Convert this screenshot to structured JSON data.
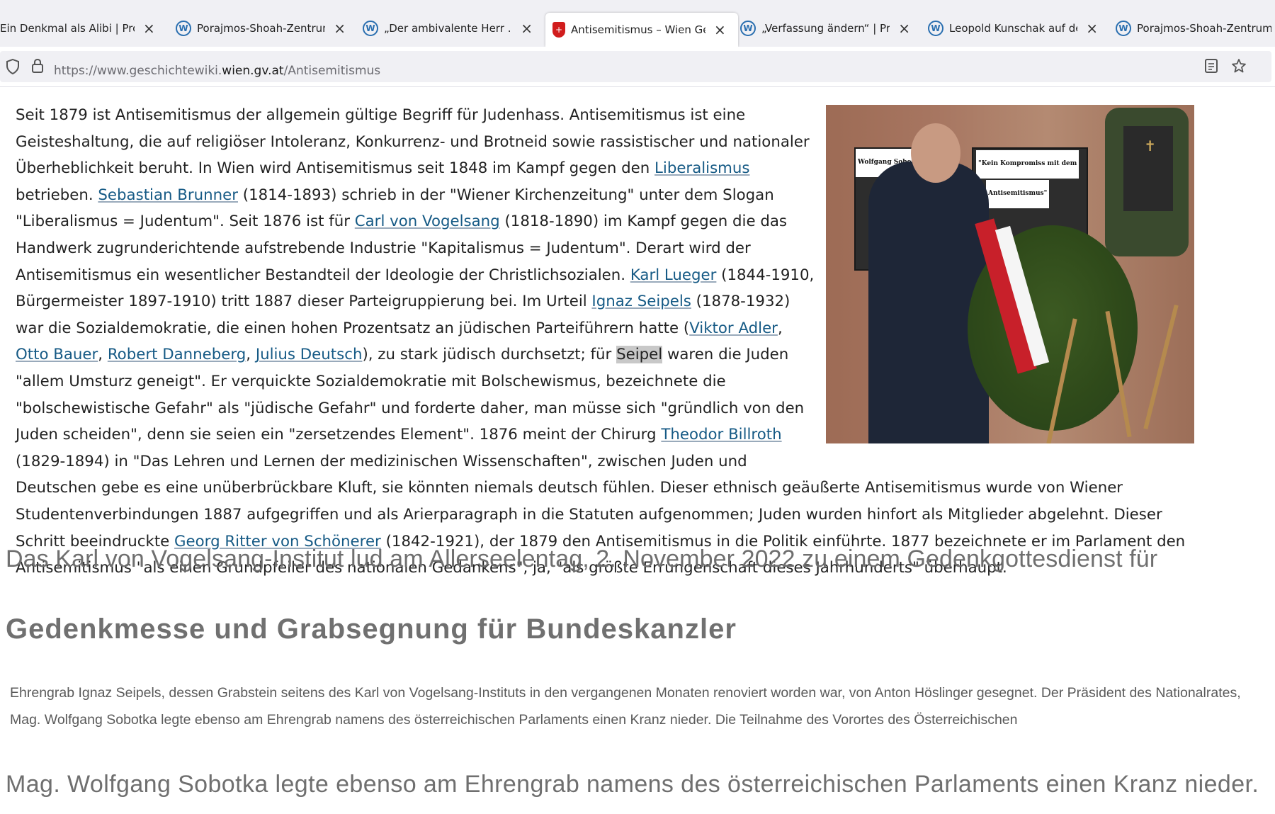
{
  "tabs": [
    {
      "title": "Ein Denkmal als Alibi | Pron",
      "icon": "wordpress-icon",
      "active": false
    },
    {
      "title": "Porajmos-Shoah-Zentrum",
      "icon": "wordpress-icon",
      "active": false
    },
    {
      "title": "„Der ambivalente Herr …“ |",
      "icon": "wordpress-icon",
      "active": false
    },
    {
      "title": "Antisemitismus – Wien Ges",
      "icon": "vienna-shield-icon",
      "active": true
    },
    {
      "title": "„Verfassung ändern“ | Pron",
      "icon": "wordpress-icon",
      "active": false
    },
    {
      "title": "Leopold Kunschak auf dem",
      "icon": "wordpress-icon",
      "active": false
    },
    {
      "title": "Porajmos-Shoah-Zentrum",
      "icon": "wordpress-icon",
      "active": false
    }
  ],
  "url": {
    "prefix": "https://www.geschichtewiki.",
    "domain": "wien.gv.at",
    "path": "/Antisemitismus"
  },
  "photo": {
    "sign_left": "Wolfgang Sobotka:",
    "sign_right_1": "\"Kein Kompromiss mit dem",
    "sign_right_2": "Antisemitismus\""
  },
  "article": {
    "s1": "Seit 1879 ist Antisemitismus der allgemein gültige Begriff für Judenhass. Antisemitismus ist eine Geisteshaltung, die auf religiöser Intoleranz, Konkurrenz- und Brotneid sowie rassistischer und nationaler Überheblichkeit beruht. In Wien wird Antisemitismus seit 1848 im Kampf gegen den ",
    "l1": "Liberalismus",
    "s2": " betrieben. ",
    "l2": "Sebastian Brunner",
    "s3": " (1814-1893) schrieb in der \"Wiener Kirchenzeitung\" unter dem Slogan \"Liberalismus = Judentum\". Seit 1876 ist für ",
    "l3": "Carl von Vogelsang",
    "s4": " (1818-1890) im Kampf gegen die das Handwerk zugrunderichtende aufstrebende Industrie \"Kapitalismus = Judentum\". Derart wird der Antisemitismus ein wesentlicher Bestandteil der Ideologie der Christlichsozialen. ",
    "l4": "Karl Lueger",
    "s5": " (1844-1910, Bürgermeister 1897-1910) tritt 1887 dieser Parteigruppierung bei. Im Urteil ",
    "l5": "Ignaz Seipels",
    "s6": " (1878-1932) war die Sozialdemokratie, die einen hohen Prozentsatz an jüdischen Parteiführern hatte (",
    "l6": "Viktor Adler",
    "c1": ", ",
    "l7": "Otto Bauer",
    "c2": ", ",
    "l8": "Robert Danneberg",
    "c3": ", ",
    "l9": "Julius Deutsch",
    "s7": "), zu stark jüdisch durchsetzt; für ",
    "hl": "Seipel",
    "s8": " waren die Juden \"allem Umsturz geneigt\". Er verquickte Sozialdemokratie mit Bolschewismus, bezeichnete die \"bolschewistische Gefahr\" als \"jüdische Gefahr\" und forderte daher, man müsse sich \"gründlich von den Juden scheiden\", denn sie seien ein \"zersetzendes Element\". 1876 meint der Chirurg ",
    "l10": "Theodor Billroth",
    "s9": " (1829-1894) in \"Das Lehren und Lernen der medizinischen Wissenschaften\", zwischen Juden und Deutschen gebe es eine unüberbrückbare Kluft, sie könnten niemals deutsch fühlen. Dieser ethnisch geäußerte Antisemitismus wurde von Wiener Studentenverbindungen 1887 aufgegriffen und als Arierparagraph in die Statuten aufgenommen; Juden wurden hinfort als Mitglieder abgelehnt. Dieser Schritt beeindruckte ",
    "l11": "Georg Ritter von Schönerer",
    "s10": " (1842-1921), der 1879 den Antisemitismus in die Politik einführte. 1877 bezeichnete er im Parlament den Antisemitismus \"als einen Grundpfeiler des nationalen Gedankens\", ja, \"als größte Errungenschaft dieses Jahrhunderts\" überhaupt."
  },
  "overlay": {
    "caption": "Das Karl von Vogelsang-Institut lud am Allerseelentag, 2. November 2022 zu einem Gedenkgottesdienst für",
    "headline": "Gedenkmesse und Grabsegnung für Bundeskanzler",
    "small": "Ehrengrab Ignaz Seipels, dessen Grabstein seitens des Karl von Vogelsang-Instituts in den vergangenen Monaten renoviert worden war, von Anton Höslinger gesegnet. Der Präsident des Nationalrates, Mag. Wolfgang Sobotka legte ebenso am Ehrengrab namens des österreichischen Parlaments einen Kranz nieder. Die Teilnahme des Vorortes des Österreichischen",
    "bottom": "Mag. Wolfgang Sobotka legte ebenso am Ehrengrab namens des österreichischen Parlaments einen Kranz nieder."
  },
  "icons": {
    "close": "×",
    "shield": "shield-icon",
    "lock": "lock-icon",
    "reader": "reader-view-icon",
    "bookmark": "bookmark-star-icon"
  }
}
